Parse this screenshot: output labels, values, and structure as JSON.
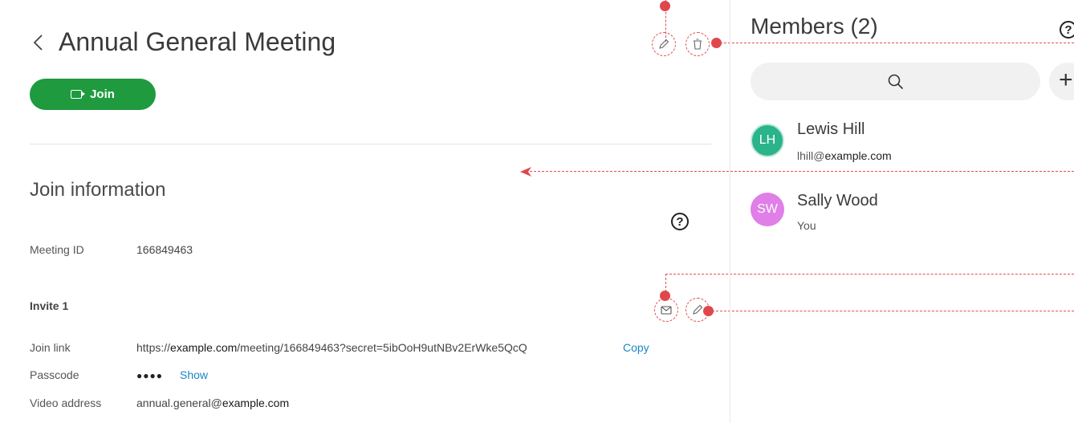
{
  "meeting": {
    "title": "Annual General Meeting",
    "join_label": "Join"
  },
  "join_info": {
    "section_title": "Join information",
    "meeting_id_label": "Meeting ID",
    "meeting_id_value": "166849463",
    "invite_title": "Invite 1",
    "join_link_label": "Join link",
    "join_link_prefix": "https://",
    "join_link_domain": "example.com",
    "join_link_path": "/meeting/166849463?secret=5ibOoH9utNBv2ErWke5QcQ",
    "copy_label": "Copy",
    "passcode_label": "Passcode",
    "passcode_masked": "●●●●",
    "show_label": "Show",
    "video_address_label": "Video address",
    "video_address_user": "annual.general@",
    "video_address_domain": "example.com"
  },
  "members": {
    "title": "Members (2)",
    "list": [
      {
        "initials": "LH",
        "name": "Lewis Hill",
        "email_user": "lhill@",
        "email_domain": "example.com",
        "color": "#2bb38a"
      },
      {
        "initials": "SW",
        "name": "Sally Wood",
        "sub": "You",
        "color": "#e07fe8"
      }
    ]
  },
  "colors": {
    "join_button": "#1f9a3f",
    "link": "#1a85c8",
    "annotation": "#e0474c"
  },
  "icons": [
    "chevron-left-icon",
    "video-camera-icon",
    "pencil-icon",
    "trash-icon",
    "help-icon",
    "mail-icon",
    "search-icon",
    "plus-icon"
  ]
}
